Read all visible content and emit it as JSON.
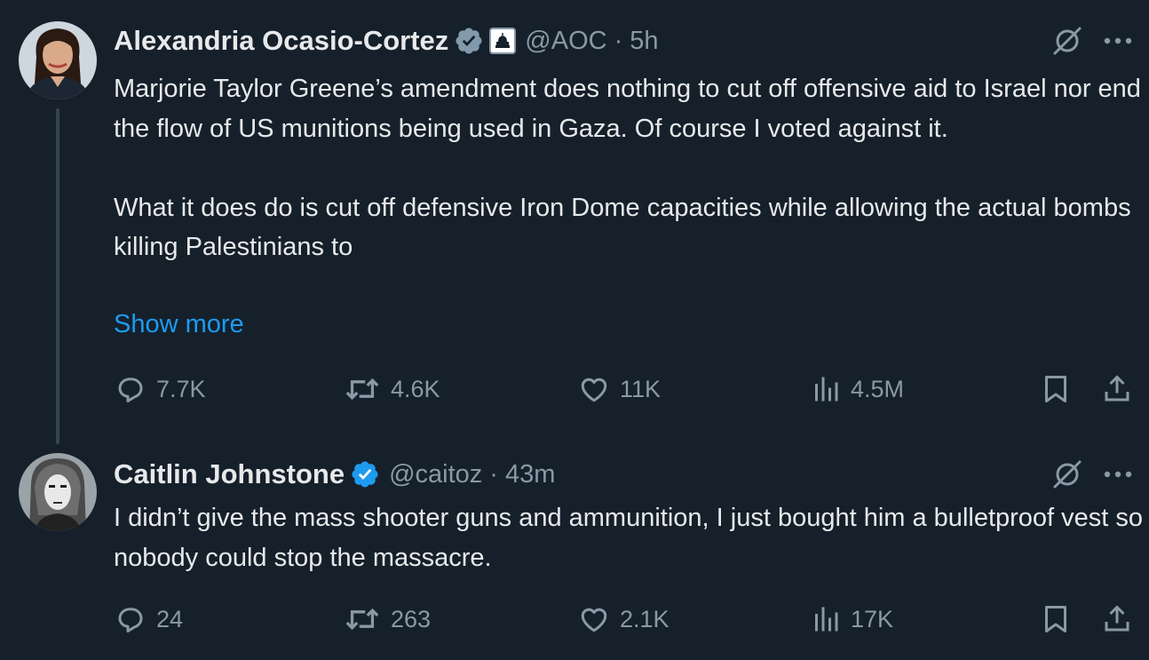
{
  "tweets": [
    {
      "name": "Alexandria Ocasio-Cortez",
      "handle": "@AOC",
      "separator": "·",
      "time": "5h",
      "text": "Marjorie Taylor Greene’s amendment does nothing to cut off offensive aid to Israel nor end the flow of US munitions being used in Gaza. Of course I voted against it.\n\nWhat it does do is cut off defensive Iron Dome capacities while allowing the actual bombs killing Palestinians to",
      "show_more": "Show more",
      "replies": "7.7K",
      "reposts": "4.6K",
      "likes": "11K",
      "views": "4.5M",
      "verified_color": "#829aab",
      "avatar_icon": "profile-photo"
    },
    {
      "name": "Caitlin Johnstone",
      "handle": "@caitoz",
      "separator": "·",
      "time": "43m",
      "text": "I didn’t give the mass shooter guns and ammunition, I just bought him a bulletproof vest so nobody could stop the massacre.",
      "replies": "24",
      "reposts": "263",
      "likes": "2.1K",
      "views": "17K",
      "verified_color": "#1d9bf0",
      "avatar_icon": "profile-photo"
    }
  ],
  "colors": {
    "background": "#15202b",
    "text": "#e7e9ea",
    "secondary": "#8b98a5",
    "link": "#1d9bf0",
    "thread_line": "#38444d"
  }
}
